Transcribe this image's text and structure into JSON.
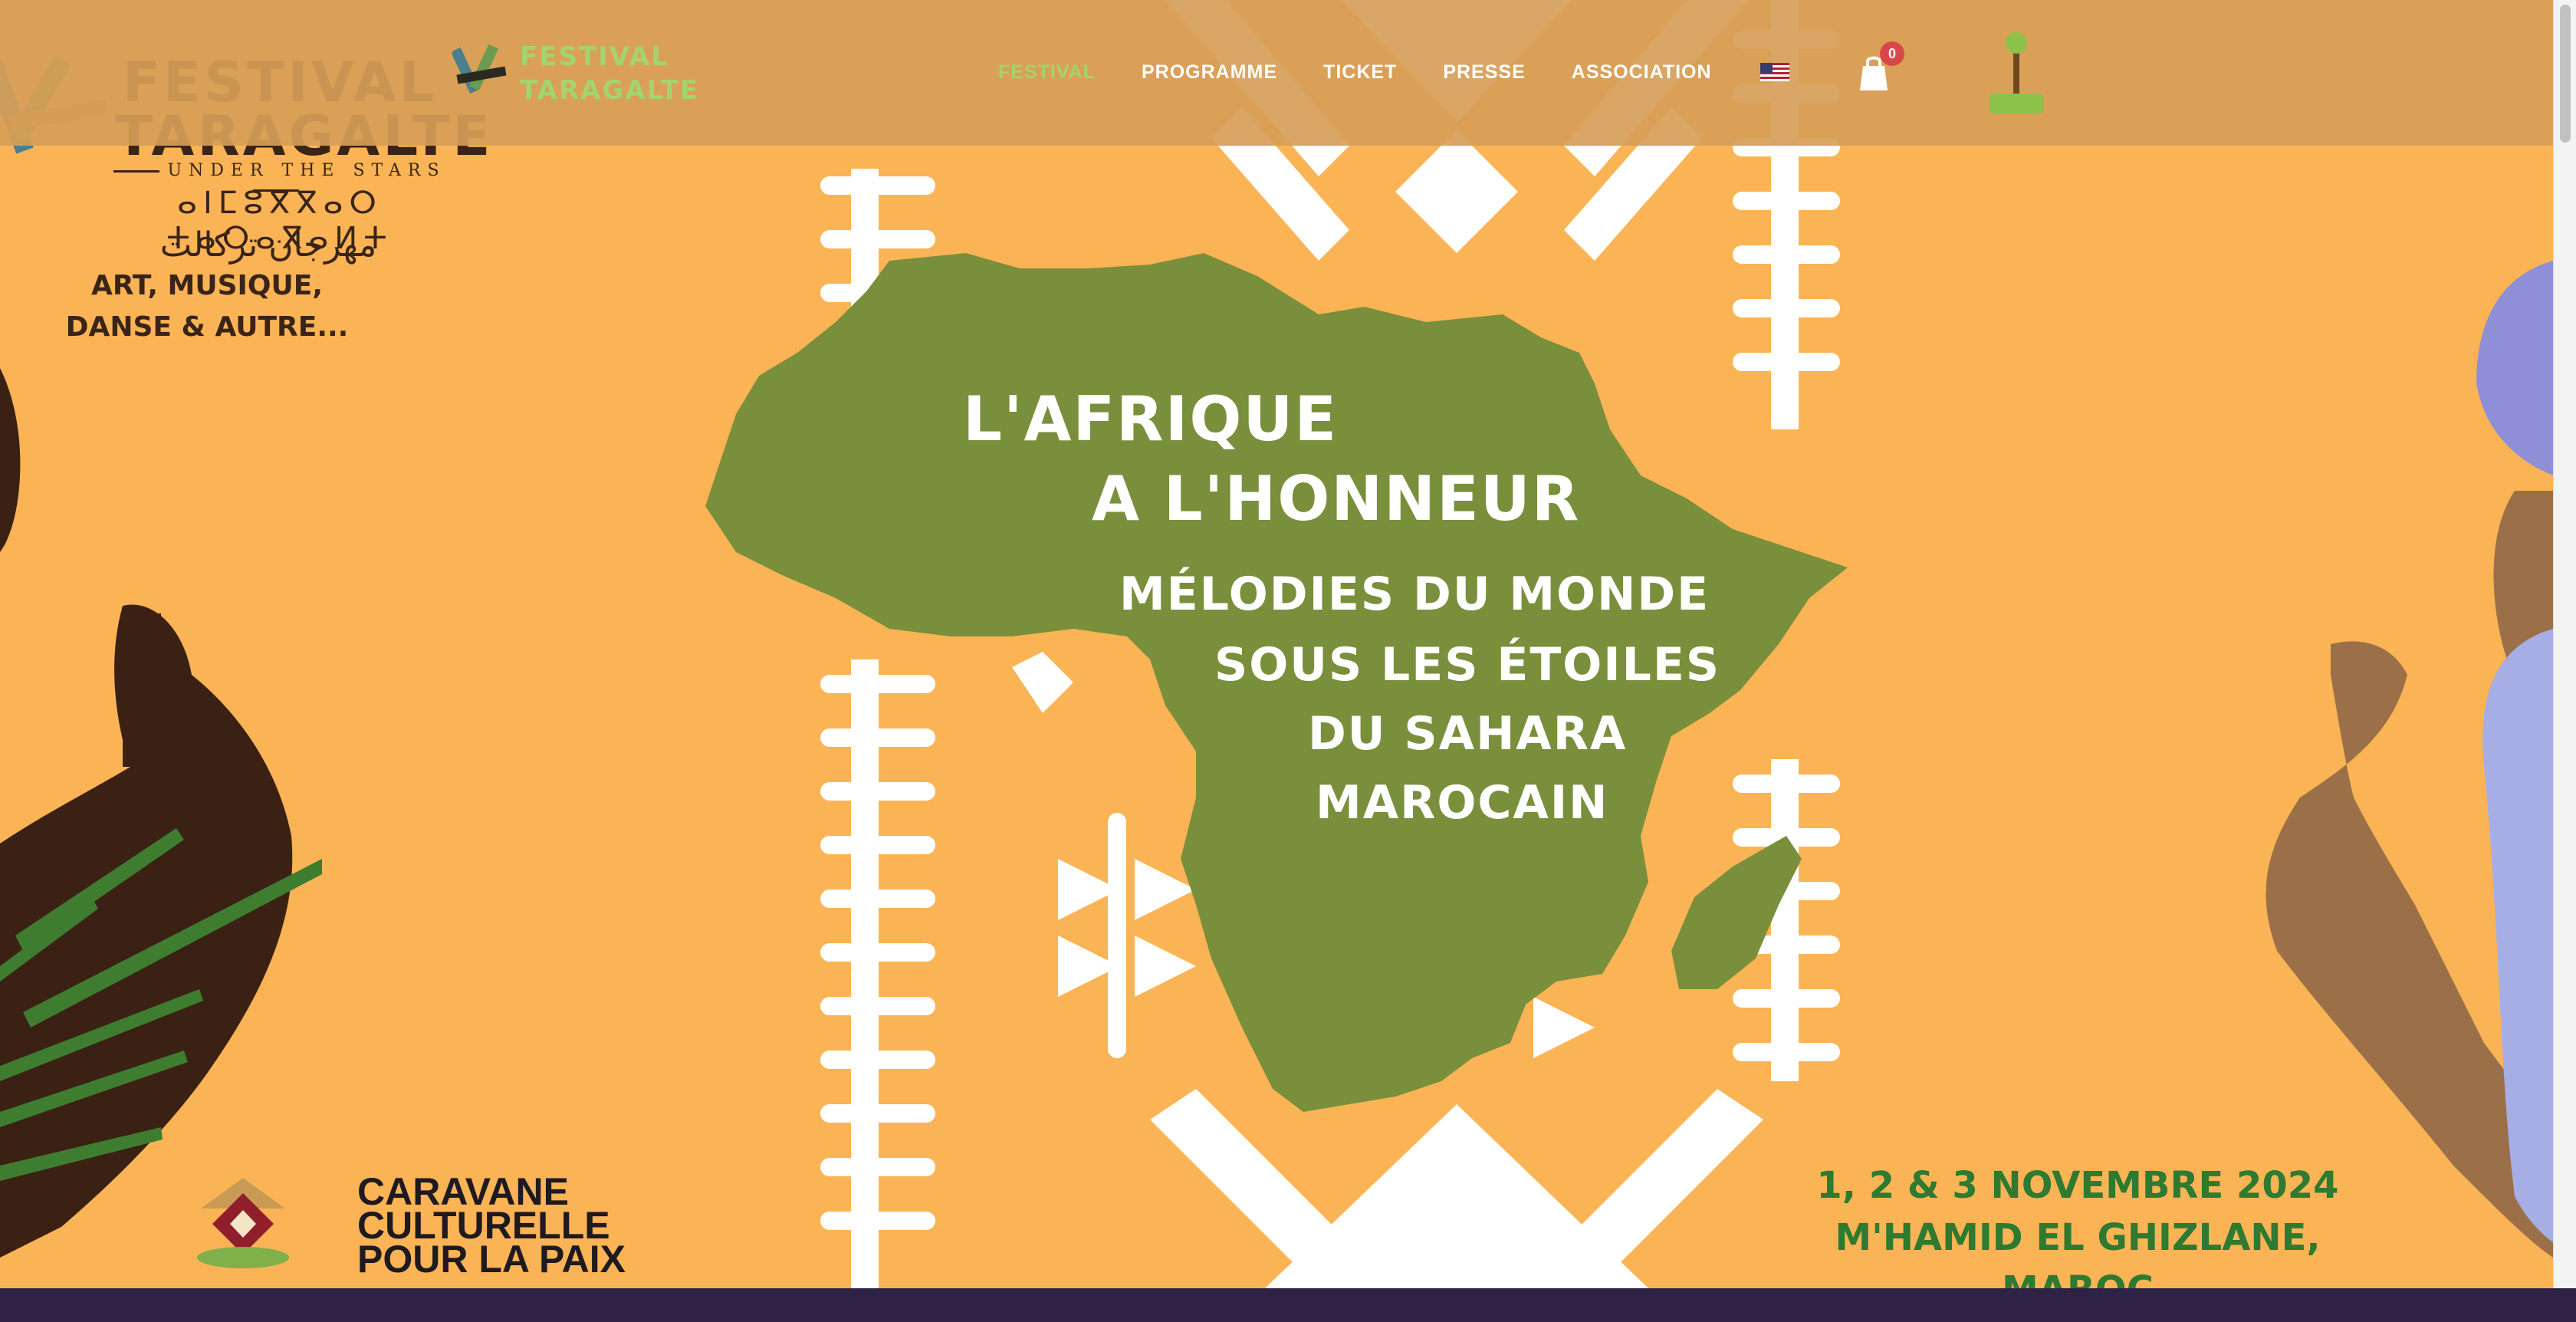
{
  "brand": {
    "nav_logo_text": "FESTIVAL TARAGALTE",
    "logo_title": "FESTIVAL TARAGALTE",
    "logo_subtitle": "UNDER THE STARS",
    "logo_tifinagh": "ⴰⵏⵎⵓⴳⴳⴰⵔ ⵜⴰⵔⴰⴳⴰⵍⵜ",
    "logo_arabic": "مهرجان تركالت",
    "logo_tagline": "ART, MUSIQUE, DANSE & AUTRE..."
  },
  "nav": {
    "items": [
      {
        "label": "FESTIVAL",
        "active": true
      },
      {
        "label": "PROGRAMME",
        "active": false
      },
      {
        "label": "TICKET",
        "active": false
      },
      {
        "label": "PRESSE",
        "active": false
      },
      {
        "label": "ASSOCIATION",
        "active": false
      }
    ],
    "language_icon": "us-flag-icon",
    "cart_icon": "shopping-bag-icon",
    "cart_count": "0",
    "accent_color": "#a4d36f"
  },
  "hero": {
    "headline_line1": "L'AFRIQUE",
    "headline_line2": "A L'HONNEUR",
    "message_line1": "MÉLODIES DU MONDE",
    "message_line2": "SOUS LES ÉTOILES",
    "message_line3": "DU SAHARA",
    "message_line4": "MAROCAIN",
    "background_color": "#fbb455",
    "continent_color": "#7a8f3b"
  },
  "footer_banner": {
    "partner_line1": "CARAVANE",
    "partner_line2": "CULTURELLE",
    "partner_line3": "POUR LA PAIX",
    "dates_line1": "1, 2 & 3 NOVEMBRE 2024",
    "dates_line2": "M'HAMID EL GHIZLANE, MAROC",
    "dates_color": "#2f7a31"
  }
}
